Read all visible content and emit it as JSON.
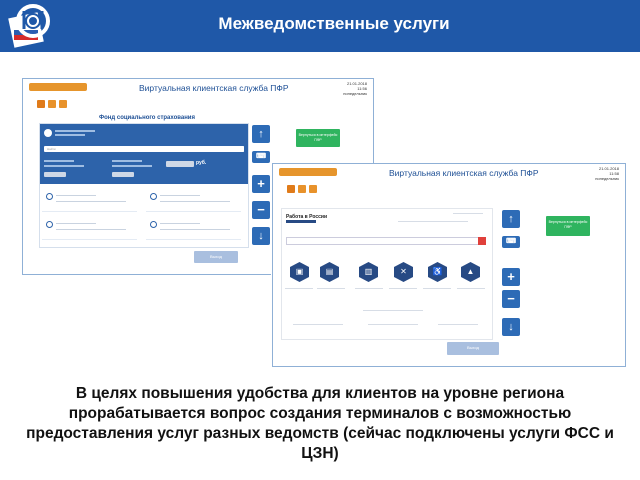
{
  "header": {
    "title": "Межведомственные услуги",
    "bg_color": "#1f58a8"
  },
  "screen_a": {
    "title": "Виртуальная клиентская служба ПФР",
    "date": "21.01.2018",
    "time": "11:56",
    "weekday": "понедельник",
    "breadcrumbs": [
      "",
      "",
      ""
    ],
    "service_title": "Фонд социального страхования",
    "search_placeholder": "Найти",
    "amount": "руб.",
    "green_button": "Вернуться в интерфейс ПФР",
    "exit_button": "Выход"
  },
  "screen_b": {
    "title": "Виртуальная клиентская служба ПФР",
    "date": "21.01.2018",
    "time": "11:58",
    "weekday": "понедельник",
    "breadcrumbs": [
      "",
      "",
      ""
    ],
    "site_title": "Работа в России",
    "green_button": "Вернуться в интерфейс ПФР",
    "exit_button": "Выход"
  },
  "caption": "В целях повышения удобства для клиентов на уровне региона прорабатывается вопрос создания терминалов с возможностью предоставления услуг разных ведомств (сейчас подключены услуги ФСС и ЦЗН)"
}
